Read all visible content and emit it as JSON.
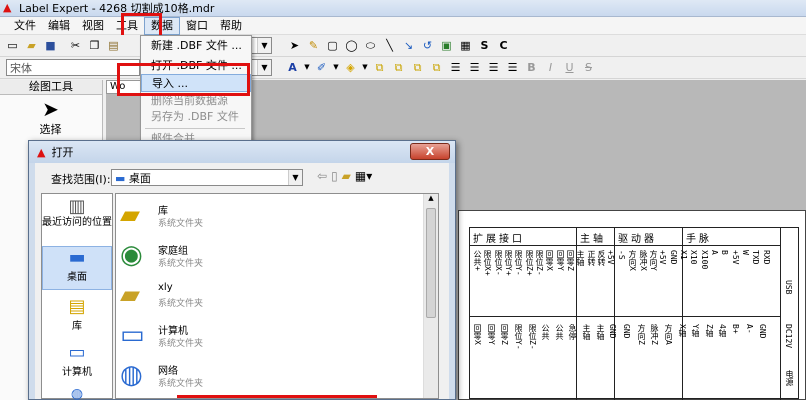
{
  "window": {
    "title": "Label Expert - 4268 切割成10格.mdr"
  },
  "menubar": {
    "items": [
      "文件",
      "编辑",
      "视图",
      "工具",
      "数据",
      "窗口",
      "帮助"
    ]
  },
  "font_combo": {
    "value": "宋体"
  },
  "toolbar_letters": {
    "bold": "B",
    "italic": "I",
    "underline": "U",
    "strike": "S",
    "s_btn": "S",
    "c_btn": "C"
  },
  "left_panel": {
    "title": "绘图工具",
    "select_label": "选择",
    "tab": "Wo"
  },
  "data_menu": {
    "items": [
      {
        "label": "新建 .DBF 文件 ...",
        "enabled": true
      },
      {
        "label": "打开 .DBF 文件 ...",
        "enabled": true
      },
      {
        "label": "导入 ...",
        "enabled": true,
        "selected": true
      },
      {
        "label": "删除当前数据源",
        "enabled": false
      },
      {
        "label": "另存为 .DBF 文件 ...",
        "enabled": false
      },
      {
        "label": "邮件合并",
        "enabled": false
      }
    ]
  },
  "dialog": {
    "title": "打开",
    "lookin_label": "查找范围(I):",
    "lookin_value": "桌面",
    "close": "X",
    "places": [
      "最近访问的位置",
      "桌面",
      "库",
      "计算机",
      "网络"
    ],
    "files": [
      {
        "name": "库",
        "type": "系统文件夹"
      },
      {
        "name": "家庭组",
        "type": "系统文件夹"
      },
      {
        "name": "xly",
        "type": "系统文件夹"
      },
      {
        "name": "计算机",
        "type": "系统文件夹"
      },
      {
        "name": "网络",
        "type": "系统文件夹"
      }
    ]
  },
  "label_paper": {
    "headers": [
      "扩展接口",
      "主轴",
      "驱动器",
      "手脉"
    ],
    "row1_cols": [
      "公共+",
      "限位X+",
      "限位X-",
      "限位Y+",
      "限位Y-",
      "限位Z+",
      "限位Z-",
      "回零X",
      "回零Y",
      "回零Z",
      "主轴",
      "正转",
      "反转",
      "+5V",
      "-S",
      "方向X",
      "脉冲X",
      "方向Y",
      "+5V",
      "GND",
      "X1",
      "X10",
      "X100",
      "A",
      "B",
      "+5V",
      "W",
      "TXD",
      "RXD"
    ],
    "row2_cols": [
      "回零X",
      "回零Y",
      "回零Z",
      "限位Y-",
      "限位Z-",
      "公共",
      "公共",
      "急停",
      "主轴",
      "主轴",
      "GND",
      "GND",
      "方向Z",
      "脉冲Z",
      "方向A",
      "X轴",
      "Y轴",
      "Z轴",
      "4轴",
      "B+",
      "A-",
      "GND"
    ],
    "side": [
      "电源",
      "DC12V",
      "USB"
    ]
  }
}
